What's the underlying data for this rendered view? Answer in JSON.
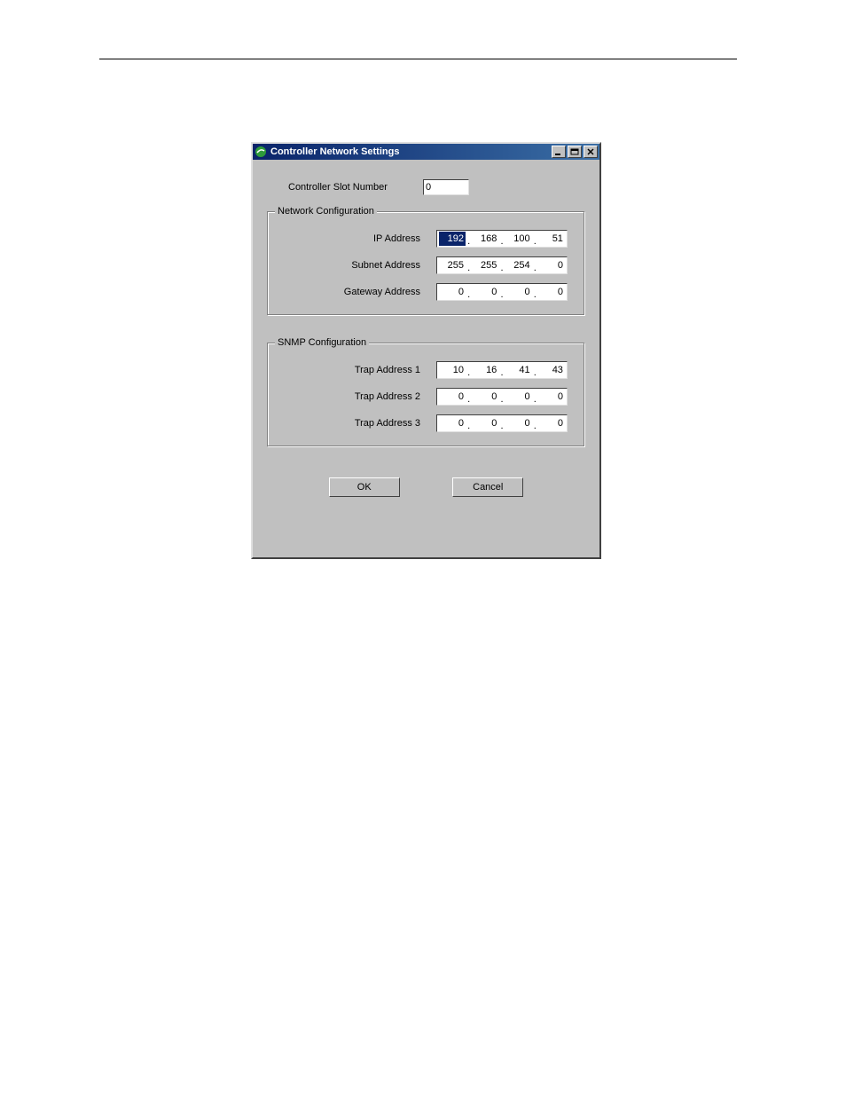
{
  "window": {
    "title": "Controller Network Settings"
  },
  "slot": {
    "label": "Controller Slot Number",
    "value": "0"
  },
  "network": {
    "legend": "Network Configuration",
    "ip": {
      "label": "IP Address",
      "o1": "192",
      "o2": "168",
      "o3": "100",
      "o4": "51"
    },
    "subnet": {
      "label": "Subnet Address",
      "o1": "255",
      "o2": "255",
      "o3": "254",
      "o4": "0"
    },
    "gateway": {
      "label": "Gateway Address",
      "o1": "0",
      "o2": "0",
      "o3": "0",
      "o4": "0"
    }
  },
  "snmp": {
    "legend": "SNMP Configuration",
    "trap1": {
      "label": "Trap Address 1",
      "o1": "10",
      "o2": "16",
      "o3": "41",
      "o4": "43"
    },
    "trap2": {
      "label": "Trap Address 2",
      "o1": "0",
      "o2": "0",
      "o3": "0",
      "o4": "0"
    },
    "trap3": {
      "label": "Trap Address 3",
      "o1": "0",
      "o2": "0",
      "o3": "0",
      "o4": "0"
    }
  },
  "buttons": {
    "ok": "OK",
    "cancel": "Cancel"
  }
}
